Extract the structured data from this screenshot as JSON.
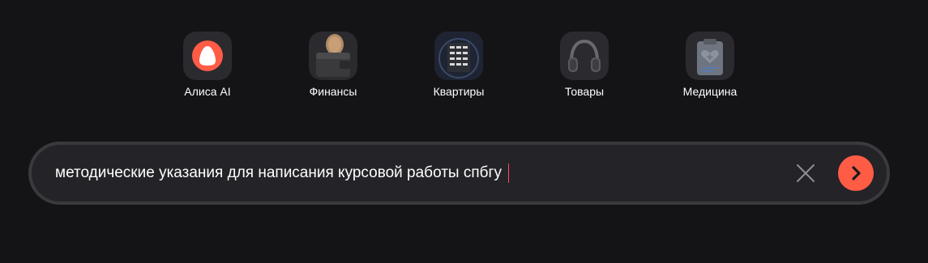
{
  "services": [
    {
      "label": "Алиса AI",
      "icon": "alice-icon"
    },
    {
      "label": "Финансы",
      "icon": "wallet-coin-icon"
    },
    {
      "label": "Квартиры",
      "icon": "building-icon"
    },
    {
      "label": "Товары",
      "icon": "headphones-icon"
    },
    {
      "label": "Медицина",
      "icon": "medical-clipboard-icon"
    }
  ],
  "search": {
    "value": "методические указания для написания курсовой работы спбгу",
    "clear_icon": "close-icon",
    "submit_icon": "arrow-right-icon"
  },
  "colors": {
    "background": "#141316",
    "accent": "#ff5c46",
    "caret": "#ff4a6b"
  }
}
